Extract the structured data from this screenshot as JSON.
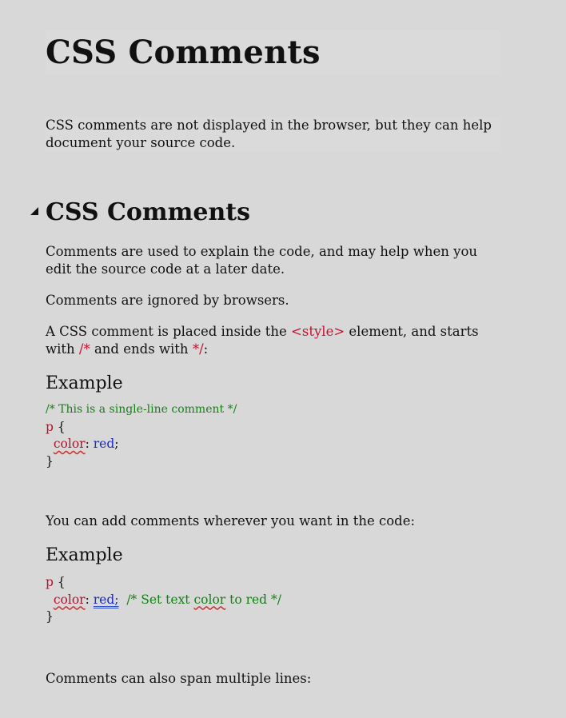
{
  "page": {
    "title": "CSS Comments",
    "intro": "CSS comments are not displayed in the browser, but they can help document your source code."
  },
  "section": {
    "heading": "CSS Comments",
    "para1": "Comments are used to explain the code, and may help when you edit the source code at a later date.",
    "para2": "Comments are ignored by browsers.",
    "para3_a": "A CSS comment is placed inside the ",
    "para3_tag": "<style>",
    "para3_b": " element, and starts with ",
    "para3_open": "/*",
    "para3_c": " and ends with ",
    "para3_close": "*/",
    "para3_d": ":",
    "example1": {
      "label": "Example",
      "comment": "/* This is a single-line comment */",
      "selector": "p",
      "open_brace": " {",
      "property": "color",
      "colon": ": ",
      "value": "red",
      "semicolon": ";",
      "close_brace": "}"
    },
    "para4": "You can add comments wherever you want in the code:",
    "example2": {
      "label": "Example",
      "selector": "p",
      "open_brace": " {",
      "property": "color",
      "colon": ": ",
      "value": "red;",
      "comment_a": "  /* Set text ",
      "comment_word": "color",
      "comment_b": " to red */",
      "close_brace": "}"
    },
    "para5": "Comments can also span multiple lines:"
  }
}
